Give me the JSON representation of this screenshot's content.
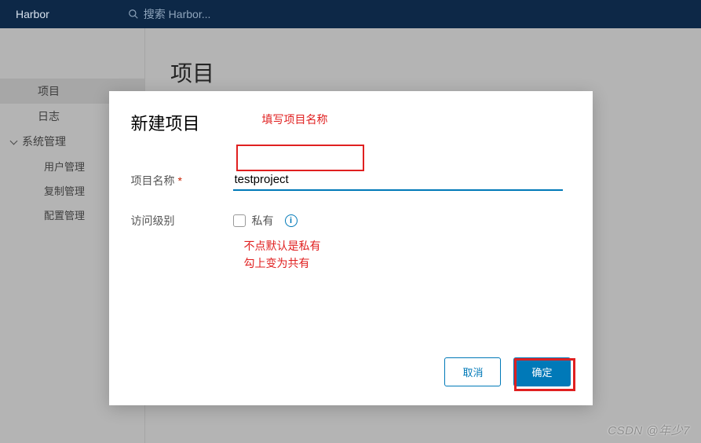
{
  "topbar": {
    "brand": "Harbor",
    "search_placeholder": "搜索 Harbor..."
  },
  "sidebar": {
    "items": [
      {
        "label": "项目",
        "type": "item",
        "active": true
      },
      {
        "label": "日志",
        "type": "item"
      },
      {
        "label": "系统管理",
        "type": "section"
      },
      {
        "label": "用户管理",
        "type": "sub"
      },
      {
        "label": "复制管理",
        "type": "sub"
      },
      {
        "label": "配置管理",
        "type": "sub"
      }
    ]
  },
  "main": {
    "page_title": "项目",
    "pager_prev": "‹"
  },
  "modal": {
    "title": "新建项目",
    "annotation_title": "填写项目名称",
    "field_name_label": "项目名称",
    "field_name_value": "testproject",
    "field_access_label": "访问级别",
    "checkbox_private_label": "私有",
    "annotation_access_line1": "不点默认是私有",
    "annotation_access_line2": "勾上变为共有",
    "cancel": "取消",
    "confirm": "确定"
  },
  "watermark": "CSDN @年少7"
}
